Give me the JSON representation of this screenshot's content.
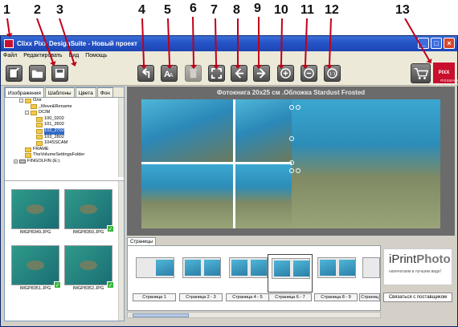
{
  "callouts": [
    "1",
    "2",
    "3",
    "4",
    "5",
    "6",
    "7",
    "8",
    "9",
    "10",
    "11",
    "12",
    "13"
  ],
  "window": {
    "title": "Clixx Pixx DesignSuite - Новый проект"
  },
  "menu": [
    "Файл",
    "Редактировать",
    "Вид",
    "Помощь"
  ],
  "tabs": [
    "Изображения",
    "Шаблоны",
    "Цвета",
    "Фон"
  ],
  "tree": [
    "Оля",
    "_Move&Rename",
    "DCIM",
    "100_0202",
    "101_2602",
    "102_2702",
    "103_2802",
    "104SSCAM",
    "FRAME",
    "TheVolumeSettingsFolder",
    "FINGOLFIN (E:)"
  ],
  "thumbnails": [
    "IMGP8349.JPG",
    "IMGP8350.JPG",
    "IMGP8351.JPG",
    "IMGP8352.JPG"
  ],
  "canvas": {
    "title": "Фотокнига 20x25 см .Обложка Stardust Frosted"
  },
  "pages": {
    "tab": "Страницы",
    "items": [
      "Страница 1",
      "Страница 2 - 3",
      "Страница 4 - 5",
      "Страница 6 - 7",
      "Страница 8 - 9",
      "Страниц"
    ]
  },
  "logo": {
    "text": "PIXX",
    "copyright": "PIXXMAGI\nAll rights reserved"
  },
  "iprint": {
    "brand_a": "iPrint",
    "brand_b": "Photo",
    "slogan": "напечатаем в лучшем виде!",
    "contact": "Связаться с поставщиком"
  }
}
